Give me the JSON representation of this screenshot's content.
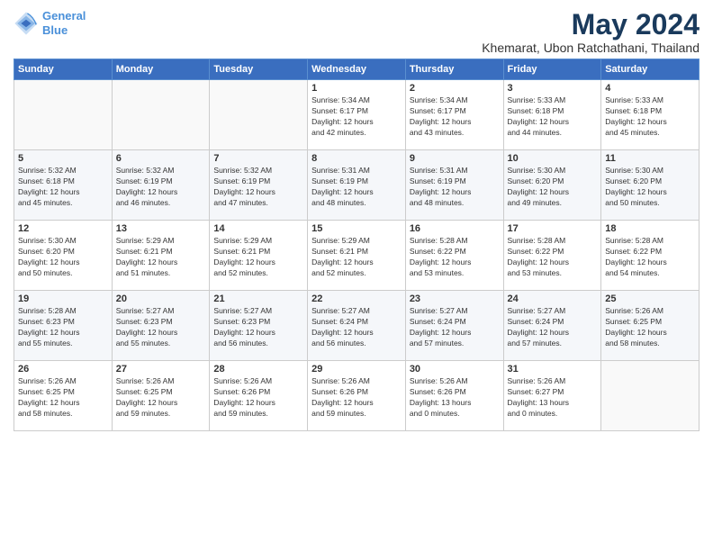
{
  "logo": {
    "line1": "General",
    "line2": "Blue"
  },
  "title": "May 2024",
  "subtitle": "Khemarat, Ubon Ratchathani, Thailand",
  "weekdays": [
    "Sunday",
    "Monday",
    "Tuesday",
    "Wednesday",
    "Thursday",
    "Friday",
    "Saturday"
  ],
  "weeks": [
    [
      {
        "day": "",
        "info": ""
      },
      {
        "day": "",
        "info": ""
      },
      {
        "day": "",
        "info": ""
      },
      {
        "day": "1",
        "info": "Sunrise: 5:34 AM\nSunset: 6:17 PM\nDaylight: 12 hours\nand 42 minutes."
      },
      {
        "day": "2",
        "info": "Sunrise: 5:34 AM\nSunset: 6:17 PM\nDaylight: 12 hours\nand 43 minutes."
      },
      {
        "day": "3",
        "info": "Sunrise: 5:33 AM\nSunset: 6:18 PM\nDaylight: 12 hours\nand 44 minutes."
      },
      {
        "day": "4",
        "info": "Sunrise: 5:33 AM\nSunset: 6:18 PM\nDaylight: 12 hours\nand 45 minutes."
      }
    ],
    [
      {
        "day": "5",
        "info": "Sunrise: 5:32 AM\nSunset: 6:18 PM\nDaylight: 12 hours\nand 45 minutes."
      },
      {
        "day": "6",
        "info": "Sunrise: 5:32 AM\nSunset: 6:19 PM\nDaylight: 12 hours\nand 46 minutes."
      },
      {
        "day": "7",
        "info": "Sunrise: 5:32 AM\nSunset: 6:19 PM\nDaylight: 12 hours\nand 47 minutes."
      },
      {
        "day": "8",
        "info": "Sunrise: 5:31 AM\nSunset: 6:19 PM\nDaylight: 12 hours\nand 48 minutes."
      },
      {
        "day": "9",
        "info": "Sunrise: 5:31 AM\nSunset: 6:19 PM\nDaylight: 12 hours\nand 48 minutes."
      },
      {
        "day": "10",
        "info": "Sunrise: 5:30 AM\nSunset: 6:20 PM\nDaylight: 12 hours\nand 49 minutes."
      },
      {
        "day": "11",
        "info": "Sunrise: 5:30 AM\nSunset: 6:20 PM\nDaylight: 12 hours\nand 50 minutes."
      }
    ],
    [
      {
        "day": "12",
        "info": "Sunrise: 5:30 AM\nSunset: 6:20 PM\nDaylight: 12 hours\nand 50 minutes."
      },
      {
        "day": "13",
        "info": "Sunrise: 5:29 AM\nSunset: 6:21 PM\nDaylight: 12 hours\nand 51 minutes."
      },
      {
        "day": "14",
        "info": "Sunrise: 5:29 AM\nSunset: 6:21 PM\nDaylight: 12 hours\nand 52 minutes."
      },
      {
        "day": "15",
        "info": "Sunrise: 5:29 AM\nSunset: 6:21 PM\nDaylight: 12 hours\nand 52 minutes."
      },
      {
        "day": "16",
        "info": "Sunrise: 5:28 AM\nSunset: 6:22 PM\nDaylight: 12 hours\nand 53 minutes."
      },
      {
        "day": "17",
        "info": "Sunrise: 5:28 AM\nSunset: 6:22 PM\nDaylight: 12 hours\nand 53 minutes."
      },
      {
        "day": "18",
        "info": "Sunrise: 5:28 AM\nSunset: 6:22 PM\nDaylight: 12 hours\nand 54 minutes."
      }
    ],
    [
      {
        "day": "19",
        "info": "Sunrise: 5:28 AM\nSunset: 6:23 PM\nDaylight: 12 hours\nand 55 minutes."
      },
      {
        "day": "20",
        "info": "Sunrise: 5:27 AM\nSunset: 6:23 PM\nDaylight: 12 hours\nand 55 minutes."
      },
      {
        "day": "21",
        "info": "Sunrise: 5:27 AM\nSunset: 6:23 PM\nDaylight: 12 hours\nand 56 minutes."
      },
      {
        "day": "22",
        "info": "Sunrise: 5:27 AM\nSunset: 6:24 PM\nDaylight: 12 hours\nand 56 minutes."
      },
      {
        "day": "23",
        "info": "Sunrise: 5:27 AM\nSunset: 6:24 PM\nDaylight: 12 hours\nand 57 minutes."
      },
      {
        "day": "24",
        "info": "Sunrise: 5:27 AM\nSunset: 6:24 PM\nDaylight: 12 hours\nand 57 minutes."
      },
      {
        "day": "25",
        "info": "Sunrise: 5:26 AM\nSunset: 6:25 PM\nDaylight: 12 hours\nand 58 minutes."
      }
    ],
    [
      {
        "day": "26",
        "info": "Sunrise: 5:26 AM\nSunset: 6:25 PM\nDaylight: 12 hours\nand 58 minutes."
      },
      {
        "day": "27",
        "info": "Sunrise: 5:26 AM\nSunset: 6:25 PM\nDaylight: 12 hours\nand 59 minutes."
      },
      {
        "day": "28",
        "info": "Sunrise: 5:26 AM\nSunset: 6:26 PM\nDaylight: 12 hours\nand 59 minutes."
      },
      {
        "day": "29",
        "info": "Sunrise: 5:26 AM\nSunset: 6:26 PM\nDaylight: 12 hours\nand 59 minutes."
      },
      {
        "day": "30",
        "info": "Sunrise: 5:26 AM\nSunset: 6:26 PM\nDaylight: 13 hours\nand 0 minutes."
      },
      {
        "day": "31",
        "info": "Sunrise: 5:26 AM\nSunset: 6:27 PM\nDaylight: 13 hours\nand 0 minutes."
      },
      {
        "day": "",
        "info": ""
      }
    ]
  ]
}
